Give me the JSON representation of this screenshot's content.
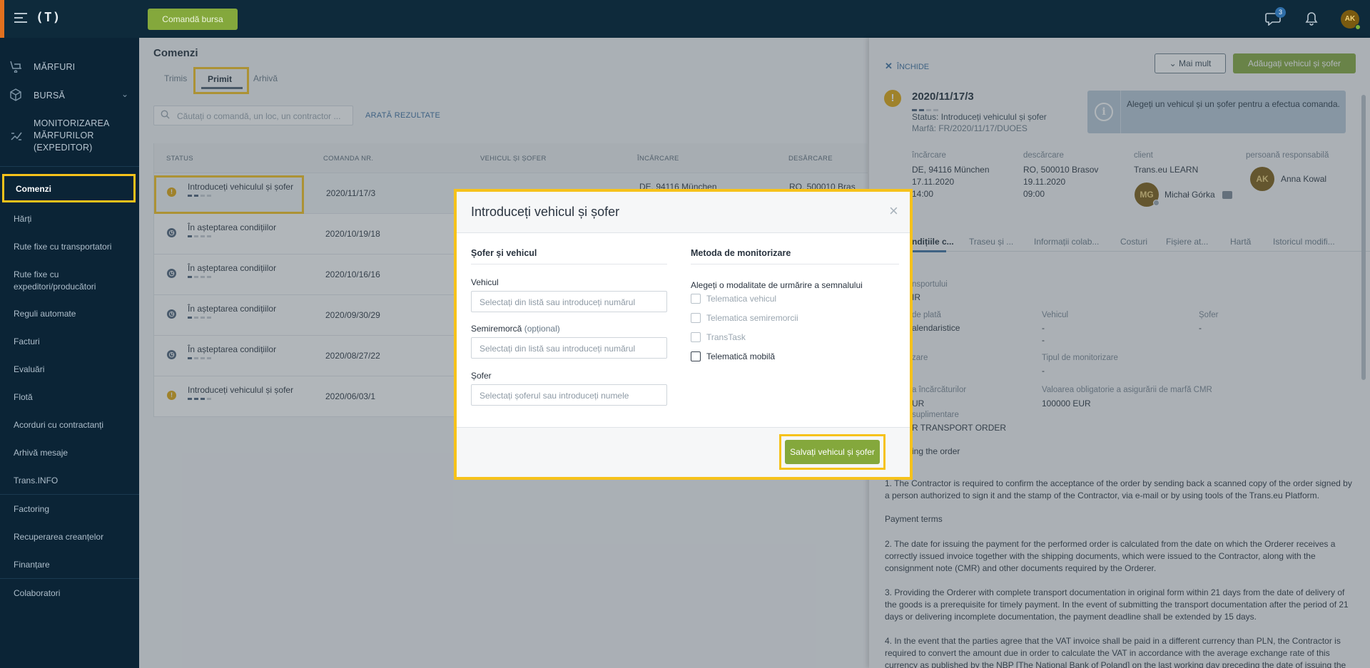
{
  "topbar": {
    "logo": "(T)",
    "bursa_button": "Comandă bursa",
    "messages_badge": "3",
    "avatar_initials": "AK"
  },
  "sidebar": {
    "marfuri": "MĂRFURI",
    "bursa": "BURSĂ",
    "monitorizare": [
      "MONITORIZAREA",
      "MĂRFURILOR",
      "(EXPEDITOR)"
    ],
    "comenzi": "Comenzi",
    "harti": "Hărți",
    "rute_fixe_transp": "Rute fixe cu transportatori",
    "rute_fixe_exp": [
      "Rute fixe cu",
      "expeditori/producători"
    ],
    "reguli": "Reguli automate",
    "facturi": "Facturi",
    "evaluari": "Evaluări",
    "flota": "Flotă",
    "acorduri": "Acorduri cu contractanți",
    "arhiva_mesaje": "Arhivă mesaje",
    "transinfo": "Trans.INFO",
    "factoring": "Factoring",
    "recuperarea": "Recuperarea creanțelor",
    "finantare": "Finanțare",
    "colaboratori": "Colaboratori"
  },
  "main": {
    "title": "Comenzi",
    "tabs": [
      "Trimis",
      "Primit",
      "Arhivă"
    ],
    "search_placeholder": "Căutați o comandă, un loc, un contractor ...",
    "show_results": "ARATĂ REZULTATE",
    "columns": [
      "STATUS",
      "COMANDA NR.",
      "VEHICUL ȘI ȘOFER",
      "ÎNCĂRCARE",
      "DESĂRCARE"
    ],
    "rows": [
      {
        "status": "Introduceți vehiculul și șofer",
        "icon": "warning",
        "number": "2020/11/17/3"
      },
      {
        "status": "În așteptarea condițiilor",
        "icon": "clock",
        "number": "2020/10/19/18"
      },
      {
        "status": "În așteptarea condițiilor",
        "icon": "clock",
        "number": "2020/10/16/16"
      },
      {
        "status": "În așteptarea condițiilor",
        "icon": "clock",
        "number": "2020/09/30/29"
      },
      {
        "status": "În așteptarea condițiilor",
        "icon": "clock",
        "number": "2020/08/27/22"
      },
      {
        "status": "Introduceți vehiculul și șofer",
        "icon": "warning",
        "number": "2020/06/03/1"
      }
    ],
    "row1_loading": "DE, 94116 München",
    "row1_unloading": "RO, 500010 Bras"
  },
  "panel": {
    "close": "ÎNCHIDE",
    "more": "Mai mult",
    "add_vehicle": "Adăugați vehicul și șofer",
    "order_no": "2020/11/17/3",
    "status_label": "Status:",
    "status_value": "Introduceți vehiculul și șofer",
    "cargo": "Marfă: FR/2020/11/17/DUOES",
    "info": "Alegeți un vehicul și un șofer pentru a efectua comanda.",
    "incarcare_h": "încărcare",
    "incarcare": [
      "DE, 94116 München",
      "17.11.2020",
      "14:00"
    ],
    "descarcare_h": "descărcare",
    "descarcare": [
      "RO, 500010 Brasov",
      "19.11.2020",
      "09:00"
    ],
    "client_h": "client",
    "client": "Trans.eu LEARN",
    "client_person_initials": "MG",
    "client_person": "Michał Górka",
    "responsabil_h": "persoană responsabilă",
    "responsabil_initials": "AK",
    "responsabil": "Anna Kowal",
    "tabs": [
      "Condițiile c...",
      "Traseu și ...",
      "Informații colab...",
      "Costuri",
      "Fișiere at...",
      "Hartă",
      "Istoricul modifi..."
    ],
    "f_transport_l": "nsportului",
    "f_transport_v": "IR",
    "f_plata_l": "de plată",
    "f_plata_v": "alendaristice",
    "f_vehicul_l": "Vehicul",
    "f_vehicul_v": [
      "-",
      "-"
    ],
    "f_sofer_l": "Șofer",
    "f_sofer_v": "-",
    "f_zare_l": "zare",
    "f_tip_l": "Tipul de monitorizare",
    "f_tip_v": "-",
    "f_incarc_l": "a încărcăturilor",
    "f_incarc_v": "UR",
    "f_oblig_l": "Valoarea obligatorie a asigurării de marfă CMR",
    "f_oblig_v": "100000 EUR",
    "f_supl_l": "suplimentare",
    "f_supl_v": "R TRANSPORT ORDER",
    "p_order": "ing the order",
    "p1": "1. The Contractor is required to confirm the acceptance of the order by sending back a scanned copy of the order signed by a person authorized to sign it and the stamp of the Contractor, via e-mail or by using tools of the Trans.eu Platform.",
    "p_terms": "Payment terms",
    "p2": "2. The date for issuing the payment for the performed order is calculated from the date on which the Orderer receives a correctly issued invoice together with the shipping documents, which were issued to the Contractor, along with the consignment note (CMR) and other documents required by the Orderer.",
    "p3": "3. Providing the Orderer with complete transport documentation in original form within 21 days from the date of delivery of the goods is a prerequisite for timely payment. In the event of submitting the transport documentation after the period of 21 days or delivering incomplete documentation, the payment deadline shall be extended by 15 days.",
    "p4": "4. In the event that the parties agree that the VAT invoice shall be paid in a different currency than PLN, the Contractor is required to convert the amount due in order to calculate the VAT in accordance with the average exchange rate of this currency as published by the NBP [The National Bank of Poland] on the last working day preceding the date of issuing the"
  },
  "modal": {
    "title": "Introduceți vehicul și șofer",
    "left_section": "Șofer și vehicul",
    "right_section": "Metoda de monitorizare",
    "vehicul_label": "Vehicul",
    "vehicul_placeholder": "Selectați din listă sau introduceți numărul",
    "semiremorca_label": "Semiremorcă",
    "semiremorca_optional": "(opțional)",
    "semiremorca_placeholder": "Selectați din listă sau introduceți numărul",
    "sofer_label": "Șofer",
    "sofer_placeholder": "Selectați șoferul sau introduceți numele",
    "tracking_hint": "Alegeți o modalitate de urmărire a semnalului",
    "options": [
      "Telematica vehicul",
      "Telematica semiremorcii",
      "TransTask",
      "Telematică mobilă"
    ],
    "save": "Salvați vehicul și șofer"
  }
}
